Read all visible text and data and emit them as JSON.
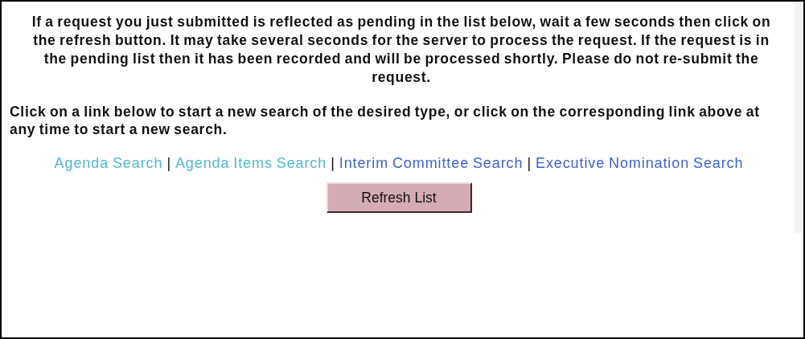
{
  "notice": "If a request you just submitted is reflected as pending in the list below, wait a few seconds then click on the refresh button. It may take several seconds for the server to process the request. If the request is in the pending list then it has been recorded and will be processed shortly. Please do not re-submit the request.",
  "instructions": "Click on a link below to start a new search of the desired type, or click on the corresponding link above at any time to start a new search.",
  "links": [
    {
      "label": "Agenda Search",
      "visited": true
    },
    {
      "separator": "|",
      "label": "Agenda Items Search",
      "visited": true
    },
    {
      "separator": "|",
      "label": "Interim Committee Search",
      "visited": false
    },
    {
      "separator": "|",
      "label": "Executive Nomination Search",
      "visited": false
    }
  ],
  "refresh_button": "Refresh List"
}
